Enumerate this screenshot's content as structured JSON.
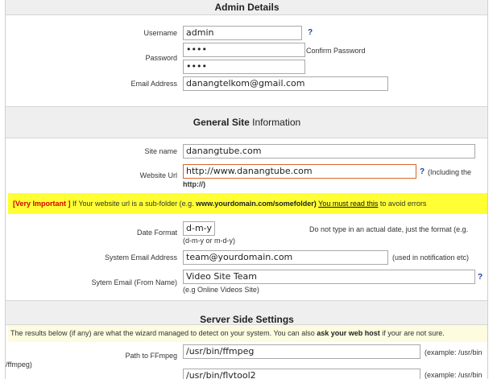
{
  "admin": {
    "title": "Admin Details",
    "username_label": "Username",
    "username_value": "admin",
    "help": "?",
    "password_label": "Password",
    "password_value": "••••",
    "confirm_label": "Confirm Password",
    "confirm_value": "••••",
    "email_label": "Email Address",
    "email_value": "danangtelkom@gmail.com"
  },
  "general": {
    "title_bold": "General Site",
    "title_rest": " Information",
    "site_name_label": "Site name",
    "site_name_value": "danangtube.com",
    "website_url_label": "Website Url",
    "website_url_value": "http://www.danangtube.com",
    "url_help": "?",
    "url_note_a": "(Including the",
    "url_note_b": "http://)",
    "warning": {
      "important": "[Very Important ]",
      "text1": " If Your website url is a sub-folder (e.g. ",
      "example": "www.yourdomain.com/somefolder)",
      "text2": " ",
      "link": "You must read this",
      "text3": " to avoid errors"
    },
    "date_format_label": "Date Format",
    "date_format_value": "d-m-y",
    "date_note_a": "Do not type in an actual date, just the format (e.g.",
    "date_note_b": "(d-m-y or m-d-y)",
    "system_email_label": "System Email Address",
    "system_email_value": "team@yourdomain.com",
    "system_email_note": "(used in notification etc)",
    "from_name_label": "Sytem Email (From Name)",
    "from_name_value": "Video Site Team",
    "from_name_help": "?",
    "from_name_note": "(e.g Online Videos Site)"
  },
  "server": {
    "title": "Server Side Settings",
    "info1": "The results below (if any) are what the wizard managed to detect on your system. You can also ",
    "info_bold": "ask your web host",
    "info2": " if your are not sure.",
    "ffmpeg_label": "Path to FFmpeg",
    "ffmpeg_value": "/usr/bin/ffmpeg",
    "ffmpeg_note_a": "(example: /usr/bin",
    "ffmpeg_note_b": "/ffmpeg)",
    "flvtool_value": "/usr/bin/flvtool2",
    "flvtool_note": "(example: /usr/bin"
  }
}
